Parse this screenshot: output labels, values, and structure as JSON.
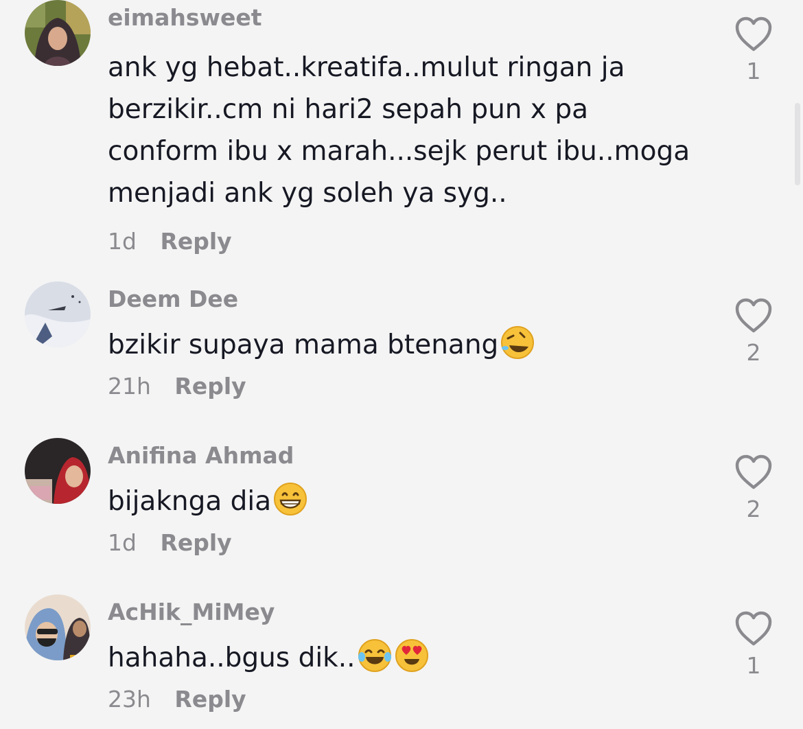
{
  "comments": [
    {
      "username": "eimahsweet",
      "lines": [
        "ank yg hebat..kreatifa..mulut ringan ja",
        "berzikir..cm ni hari2 sepah pun x pa",
        "conform ibu x marah...sejk perut ibu..moga",
        "menjadi ank yg soleh ya syg.."
      ],
      "time": "1d",
      "reply_label": "Reply",
      "likes": "1",
      "emoji": []
    },
    {
      "username": "Deem Dee",
      "lines": [
        "bzikir supaya mama btenang"
      ],
      "time": "21h",
      "reply_label": "Reply",
      "likes": "2",
      "emoji": [
        "rolling-on-floor-laughing"
      ]
    },
    {
      "username": "Anifina Ahmad",
      "lines": [
        "bijaknga dia"
      ],
      "time": "1d",
      "reply_label": "Reply",
      "likes": "2",
      "emoji": [
        "grinning-face"
      ]
    },
    {
      "username": "AcHik_MiMey",
      "lines": [
        "hahaha..bgus dik.."
      ],
      "time": "23h",
      "reply_label": "Reply",
      "likes": "1",
      "emoji": [
        "tears-of-joy",
        "heart-eyes"
      ]
    }
  ],
  "icons": {
    "like": "heart-outline-icon"
  },
  "colors": {
    "background": "#f4f4f4",
    "text": "#161823",
    "muted": "#8a8a8f"
  }
}
